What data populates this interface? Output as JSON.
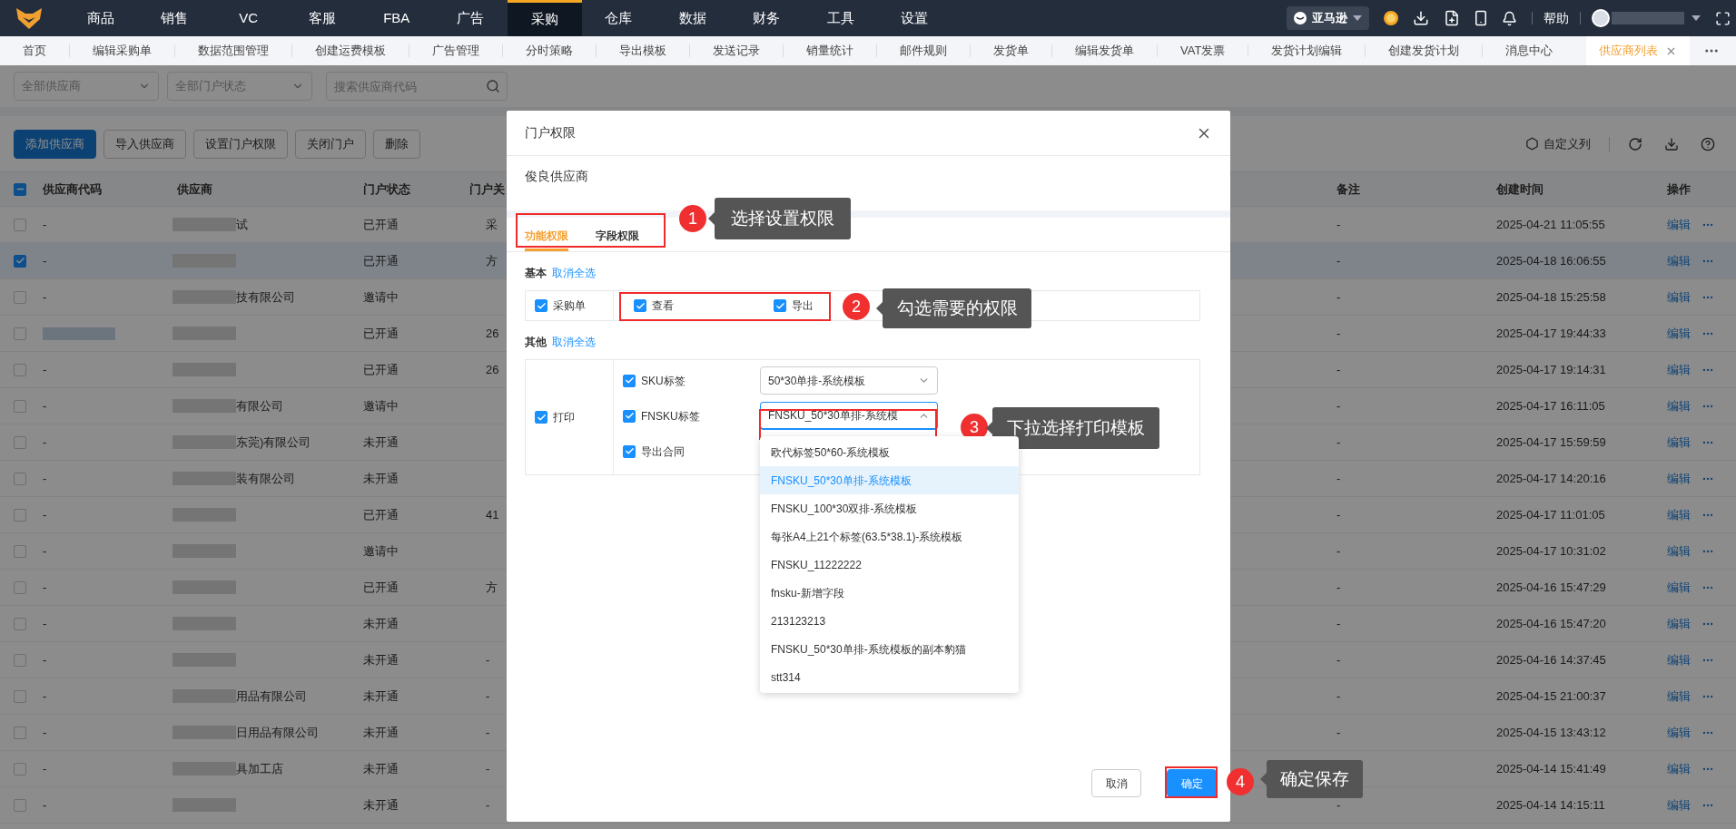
{
  "top_nav": {
    "items": [
      {
        "label": "商品",
        "selected": false
      },
      {
        "label": "销售",
        "selected": false
      },
      {
        "label": "VC",
        "selected": false
      },
      {
        "label": "客服",
        "selected": false
      },
      {
        "label": "FBA",
        "selected": false
      },
      {
        "label": "广告",
        "selected": false
      },
      {
        "label": "采购",
        "selected": true
      },
      {
        "label": "仓库",
        "selected": false
      },
      {
        "label": "数据",
        "selected": false
      },
      {
        "label": "财务",
        "selected": false
      },
      {
        "label": "工具",
        "selected": false
      },
      {
        "label": "设置",
        "selected": false
      }
    ],
    "platform": "亚马逊",
    "help": "帮助"
  },
  "tabs": [
    {
      "label": "首页",
      "selected": false
    },
    {
      "label": "编辑采购单",
      "selected": false
    },
    {
      "label": "数据范围管理",
      "selected": false
    },
    {
      "label": "创建运费模板",
      "selected": false
    },
    {
      "label": "广告管理",
      "selected": false
    },
    {
      "label": "分时策略",
      "selected": false
    },
    {
      "label": "导出模板",
      "selected": false
    },
    {
      "label": "发送记录",
      "selected": false
    },
    {
      "label": "销量统计",
      "selected": false
    },
    {
      "label": "邮件规则",
      "selected": false
    },
    {
      "label": "发货单",
      "selected": false
    },
    {
      "label": "编辑发货单",
      "selected": false
    },
    {
      "label": "VAT发票",
      "selected": false
    },
    {
      "label": "发货计划编辑",
      "selected": false
    },
    {
      "label": "创建发货计划",
      "selected": false
    },
    {
      "label": "消息中心",
      "selected": false
    },
    {
      "label": "供应商列表",
      "selected": true
    }
  ],
  "filters": {
    "supplier_select": "全部供应商",
    "status_select": "全部门户状态",
    "search": {
      "placeholder": "搜索供应商代码"
    }
  },
  "toolbar": {
    "buttons": [
      {
        "label": "添加供应商",
        "kind": "primary"
      },
      {
        "label": "导入供应商",
        "kind": "default"
      },
      {
        "label": "设置门户权限",
        "kind": "default"
      },
      {
        "label": "关闭门户",
        "kind": "default"
      },
      {
        "label": "删除",
        "kind": "default"
      }
    ],
    "custom_columns": "自定义列"
  },
  "table": {
    "header_checkbox": {
      "indeterminate": true
    },
    "columns": [
      "供应商代码",
      "供应商",
      "门户状态",
      "门户关",
      "备注",
      "创建时间",
      "操作"
    ],
    "rows": [
      {
        "checked": false,
        "selected": false,
        "code": "-",
        "supplier": "试",
        "status": "已开通",
        "portal": "采",
        "remark": "-",
        "created": "2025-04-21 11:05:55",
        "action": "编辑"
      },
      {
        "checked": true,
        "selected": true,
        "code": "-",
        "status": "已开通",
        "portal": "方",
        "remark": "-",
        "created": "2025-04-18 16:06:55",
        "action": "编辑"
      },
      {
        "checked": false,
        "selected": false,
        "code": "-",
        "supplier": "技有限公司",
        "status": "邀请中",
        "remark": "-",
        "created": "2025-04-18 15:25:58",
        "action": "编辑"
      },
      {
        "checked": false,
        "selected": false,
        "status": "已开通",
        "portal": "26",
        "remark": "-",
        "created": "2025-04-17 19:44:33",
        "action": "编辑"
      },
      {
        "checked": false,
        "selected": false,
        "code": "-",
        "status": "已开通",
        "portal": "26",
        "remark": "-",
        "created": "2025-04-17 19:14:31",
        "action": "编辑"
      },
      {
        "checked": false,
        "selected": false,
        "code": "-",
        "supplier": "有限公司",
        "status": "邀请中",
        "remark": "-",
        "created": "2025-04-17 16:11:05",
        "action": "编辑"
      },
      {
        "checked": false,
        "selected": false,
        "code": "-",
        "supplier": "东莞)有限公司",
        "status": "未开通",
        "remark": "-",
        "created": "2025-04-17 15:59:59",
        "action": "编辑"
      },
      {
        "checked": false,
        "selected": false,
        "code": "-",
        "supplier": "装有限公司",
        "status": "未开通",
        "remark": "-",
        "created": "2025-04-17 14:20:16",
        "action": "编辑"
      },
      {
        "checked": false,
        "selected": false,
        "code": "-",
        "status": "已开通",
        "portal": "41",
        "remark": "-",
        "created": "2025-04-17 11:01:05",
        "action": "编辑"
      },
      {
        "checked": false,
        "selected": false,
        "code": "-",
        "status": "邀请中",
        "remark": "-",
        "created": "2025-04-17 10:31:02",
        "action": "编辑"
      },
      {
        "checked": false,
        "selected": false,
        "code": "-",
        "status": "已开通",
        "portal": "方",
        "remark": "-",
        "created": "2025-04-16 15:47:29",
        "action": "编辑"
      },
      {
        "checked": false,
        "selected": false,
        "code": "-",
        "status": "未开通",
        "remark": "-",
        "created": "2025-04-16 15:47:20",
        "action": "编辑"
      },
      {
        "checked": false,
        "selected": false,
        "code": "-",
        "status": "未开通",
        "portal": "-",
        "remark": "-",
        "created": "2025-04-16 14:37:45",
        "action": "编辑"
      },
      {
        "checked": false,
        "selected": false,
        "code": "-",
        "supplier": "用品有限公司",
        "status": "未开通",
        "portal": "-",
        "remark": "-",
        "created": "2025-04-15 21:00:37",
        "action": "编辑"
      },
      {
        "checked": false,
        "selected": false,
        "code": "-",
        "supplier": "日用品有限公司",
        "status": "未开通",
        "portal": "-",
        "remark": "-",
        "created": "2025-04-15 13:43:12",
        "action": "编辑"
      },
      {
        "checked": false,
        "selected": false,
        "code": "-",
        "supplier": "具加工店",
        "status": "未开通",
        "portal": "-",
        "created": "2025-04-14 15:41:49",
        "action": "编辑"
      },
      {
        "checked": false,
        "selected": false,
        "code": "-",
        "status": "未开通",
        "portal": "-",
        "remark": "-",
        "created": "2025-04-14 14:15:11",
        "action": "编辑"
      }
    ]
  },
  "dialog": {
    "title": "门户权限",
    "supplier": "俊良供应商",
    "tabs": [
      {
        "label": "功能权限",
        "selected": true
      },
      {
        "label": "字段权限",
        "selected": false
      }
    ],
    "sections": [
      {
        "title": "基本",
        "toggle": "取消全选",
        "kind": "inline",
        "group": {
          "label": "采购单",
          "checked": true
        },
        "options": [
          {
            "label": "查看",
            "checked": true
          },
          {
            "label": "导出",
            "checked": true
          }
        ]
      },
      {
        "title": "其他",
        "toggle": "取消全选",
        "kind": "stacked",
        "group": {
          "label": "打印",
          "checked": true
        },
        "options": [
          {
            "label": "SKU标签",
            "checked": true,
            "select": {
              "value": "50*30单排-系统模板",
              "open": false
            }
          },
          {
            "label": "FNSKU标签",
            "checked": true,
            "select": {
              "value": "FNSKU_50*30单排-系统模",
              "open": true,
              "options": [
                {
                  "label": "欧代标签50*60-系统模板",
                  "selected": false
                },
                {
                  "label": "FNSKU_50*30单排-系统模板",
                  "selected": true
                },
                {
                  "label": "FNSKU_100*30双排-系统模板",
                  "selected": false
                },
                {
                  "label": "每张A4上21个标签(63.5*38.1)-系统模板",
                  "selected": false
                },
                {
                  "label": "FNSKU_11222222",
                  "selected": false
                },
                {
                  "label": "fnsku-新增字段",
                  "selected": false
                },
                {
                  "label": "213123213",
                  "selected": false
                },
                {
                  "label": "FNSKU_50*30单排-系统模板的副本豹猫",
                  "selected": false
                },
                {
                  "label": "stt314",
                  "selected": false
                }
              ]
            }
          },
          {
            "label": "导出合同",
            "checked": true
          }
        ]
      }
    ],
    "buttons": [
      {
        "label": "取消",
        "kind": "default"
      },
      {
        "label": "确定",
        "kind": "primary"
      }
    ]
  },
  "annotations": [
    {
      "number": "1",
      "text": "选择设置权限"
    },
    {
      "number": "2",
      "text": "勾选需要的权限"
    },
    {
      "number": "3",
      "text": "下拉选择打印模板"
    },
    {
      "number": "4",
      "text": "确定保存"
    }
  ]
}
